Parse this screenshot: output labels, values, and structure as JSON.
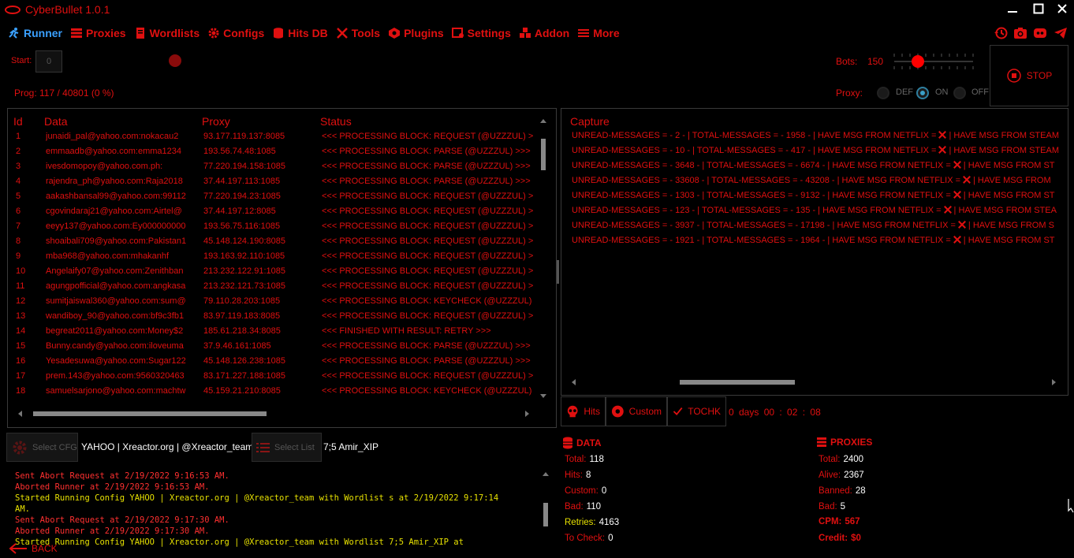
{
  "app": {
    "title": "CyberBullet 1.0.1"
  },
  "nav": [
    {
      "label": "Runner",
      "icon": "runner-icon"
    },
    {
      "label": "Proxies",
      "icon": "proxies-icon"
    },
    {
      "label": "Wordlists",
      "icon": "wordlists-icon"
    },
    {
      "label": "Configs",
      "icon": "gear-icon"
    },
    {
      "label": "Hits DB",
      "icon": "database-icon"
    },
    {
      "label": "Tools",
      "icon": "tools-icon"
    },
    {
      "label": "Plugins",
      "icon": "plugins-icon"
    },
    {
      "label": "Settings",
      "icon": "settings-icon"
    },
    {
      "label": "Addon",
      "icon": "addon-icon"
    },
    {
      "label": "More",
      "icon": "menu-icon"
    }
  ],
  "controls": {
    "start_label": "Start:",
    "start_value": "0",
    "prog": "Prog: 117 / 40801 (0 %)",
    "bots_label": "Bots:",
    "bots_value": "150",
    "bots_fraction": 0.3,
    "stop_label": "STOP",
    "proxy_label": "Proxy:",
    "proxy_options": [
      "DEF",
      "ON",
      "OFF"
    ],
    "proxy_selected": "ON"
  },
  "grid": {
    "headers": [
      "Id",
      "Data",
      "Proxy",
      "Status"
    ],
    "rows": [
      {
        "id": "1",
        "data": "junaidi_pal@yahoo.com:nokacau2",
        "proxy": "93.177.119.137:8085",
        "status": "<<< PROCESSING BLOCK: REQUEST (@UZZZUL) >"
      },
      {
        "id": "2",
        "data": "emmaadb@yahoo.com:emma1234",
        "proxy": "193.56.74.48:1085",
        "status": "<<< PROCESSING BLOCK: PARSE (@UZZZUL) >>>"
      },
      {
        "id": "3",
        "data": "ivesdomopoy@yahoo.com.ph:",
        "proxy": "77.220.194.158:1085",
        "status": "<<< PROCESSING BLOCK: PARSE (@UZZZUL) >>>"
      },
      {
        "id": "4",
        "data": "rajendra_ph@yahoo.com:Raja2018",
        "proxy": "37.44.197.113:1085",
        "status": "<<< PROCESSING BLOCK: PARSE (@UZZZUL) >>>"
      },
      {
        "id": "5",
        "data": "aakashbansal99@yahoo.com:99112",
        "proxy": "77.220.194.23:1085",
        "status": "<<< PROCESSING BLOCK: REQUEST (@UZZZUL) >"
      },
      {
        "id": "6",
        "data": "cgovindaraj21@yahoo.com:Airtel@",
        "proxy": "37.44.197.12:8085",
        "status": "<<< PROCESSING BLOCK: REQUEST (@UZZZUL) >"
      },
      {
        "id": "7",
        "data": "eeyy137@yahoo.com:Ey000000000",
        "proxy": "193.56.75.116:1085",
        "status": "<<< PROCESSING BLOCK: REQUEST (@UZZZUL) >"
      },
      {
        "id": "8",
        "data": "shoaibali709@yahoo.com:Pakistan1",
        "proxy": "45.148.124.190:8085",
        "status": "<<< PROCESSING BLOCK: REQUEST (@UZZZUL) >"
      },
      {
        "id": "9",
        "data": "mba968@yahoo.com:mhakanhf",
        "proxy": "193.163.92.110:1085",
        "status": "<<< PROCESSING BLOCK: REQUEST (@UZZZUL) >"
      },
      {
        "id": "10",
        "data": "Angelaify07@yahoo.com:Zenithban",
        "proxy": "213.232.122.91:1085",
        "status": "<<< PROCESSING BLOCK: REQUEST (@UZZZUL) >"
      },
      {
        "id": "11",
        "data": "agungpofficial@yahoo.com:angkasa",
        "proxy": "213.232.121.73:1085",
        "status": "<<< PROCESSING BLOCK: REQUEST (@UZZZUL) >"
      },
      {
        "id": "12",
        "data": "sumitjaiswal360@yahoo.com:sum@",
        "proxy": "79.110.28.203:1085",
        "status": "<<< PROCESSING BLOCK: KEYCHECK (@UZZZUL)"
      },
      {
        "id": "13",
        "data": "wandiboy_90@yahoo.com:bf9c3fb1",
        "proxy": "83.97.119.183:8085",
        "status": "<<< PROCESSING BLOCK: REQUEST (@UZZZUL) >"
      },
      {
        "id": "14",
        "data": "begreat2011@yahoo.com:Money$2",
        "proxy": "185.61.218.34:8085",
        "status": "<<< FINISHED WITH RESULT: RETRY >>>"
      },
      {
        "id": "15",
        "data": "Bunny.candy@yahoo.com:iloveuma",
        "proxy": "37.9.46.161:1085",
        "status": "<<< PROCESSING BLOCK: PARSE (@UZZZUL) >>>"
      },
      {
        "id": "16",
        "data": "Yesadesuwa@yahoo.com:Sugar122",
        "proxy": "45.148.126.238:1085",
        "status": "<<< PROCESSING BLOCK: PARSE (@UZZZUL) >>>"
      },
      {
        "id": "17",
        "data": "prem.143@yahoo.com:9560320463",
        "proxy": "83.171.227.188:1085",
        "status": "<<< PROCESSING BLOCK: REQUEST (@UZZZUL) >"
      },
      {
        "id": "18",
        "data": "samuelsarjono@yahoo.com:machtw",
        "proxy": "45.159.21.210:8085",
        "status": "<<< PROCESSING BLOCK: KEYCHECK (@UZZZUL)"
      }
    ]
  },
  "capture": {
    "header": "Capture",
    "rows": [
      {
        "a": "UNREAD-MESSAGES = - 2 - | TOTAL-MESSAGES = - 1958 - | HAVE MSG FROM NETFLIX =",
        "b": "| HAVE MSG FROM STEAM"
      },
      {
        "a": "UNREAD-MESSAGES = - 10 - | TOTAL-MESSAGES = - 417 - | HAVE MSG FROM NETFLIX =",
        "b": "| HAVE MSG FROM STEAM"
      },
      {
        "a": "UNREAD-MESSAGES = - 3648 - | TOTAL-MESSAGES = - 6674 - | HAVE MSG FROM NETFLIX =",
        "b": "| HAVE MSG FROM ST"
      },
      {
        "a": "UNREAD-MESSAGES = - 33608 - | TOTAL-MESSAGES = - 43208 - | HAVE MSG FROM NETFLIX =",
        "b": "| HAVE MSG FROM"
      },
      {
        "a": "UNREAD-MESSAGES = - 1303 - | TOTAL-MESSAGES = - 9132 - | HAVE MSG FROM NETFLIX =",
        "b": "| HAVE MSG FROM ST"
      },
      {
        "a": "UNREAD-MESSAGES = - 123 - | TOTAL-MESSAGES = - 135 - | HAVE MSG FROM NETFLIX =",
        "b": "| HAVE MSG FROM STEA"
      },
      {
        "a": "UNREAD-MESSAGES = - 3937 - | TOTAL-MESSAGES = - 17198 - | HAVE MSG FROM NETFLIX =",
        "b": "| HAVE MSG FROM S"
      },
      {
        "a": "UNREAD-MESSAGES = - 1921 - | TOTAL-MESSAGES = - 1964 - | HAVE MSG FROM NETFLIX =",
        "b": "| HAVE MSG FROM ST"
      }
    ]
  },
  "hit_tabs": {
    "hits": "Hits",
    "custom": "Custom",
    "tochk": "TOCHK"
  },
  "timer": "0  days  00 : 02 : 08",
  "bottom": {
    "select_cfg": "Select CFG",
    "cfg_name": "YAHOO | Xreactor.org | @Xreactor_team",
    "select_list": "Select List",
    "list_name": "7;5 Amir_XIP",
    "back": "BACK"
  },
  "log": [
    {
      "t": "Sent Abort Request at 2/19/2022 9:16:53 AM.",
      "c": "red"
    },
    {
      "t": "Aborted Runner at 2/19/2022 9:16:53 AM.",
      "c": "red"
    },
    {
      "t": "Started Running Config YAHOO | Xreactor.org | @Xreactor_team with Wordlist s at 2/19/2022 9:17:14",
      "c": "yel"
    },
    {
      "t": "AM.",
      "c": "yel"
    },
    {
      "t": "Sent Abort Request at 2/19/2022 9:17:30 AM.",
      "c": "red"
    },
    {
      "t": "Aborted Runner at 2/19/2022 9:17:30 AM.",
      "c": "red"
    },
    {
      "t": "Started Running Config YAHOO | Xreactor.org | @Xreactor_team with Wordlist 7;5 Amir_XIP at",
      "c": "yel"
    }
  ],
  "data_stats": {
    "title": "DATA",
    "total": {
      "label": "Total:",
      "value": "118"
    },
    "hits": {
      "label": "Hits:",
      "value": "8"
    },
    "custom": {
      "label": "Custom:",
      "value": "0"
    },
    "bad": {
      "label": "Bad:",
      "value": "110"
    },
    "retries": {
      "label": "Retries:",
      "value": "4163"
    },
    "tocheck": {
      "label": "To Check:",
      "value": "0"
    }
  },
  "proxy_stats": {
    "title": "PROXIES",
    "total": {
      "label": "Total:",
      "value": "2400"
    },
    "alive": {
      "label": "Alive:",
      "value": "2367"
    },
    "banned": {
      "label": "Banned:",
      "value": "28"
    },
    "bad": {
      "label": "Bad:",
      "value": "5"
    },
    "cpm": {
      "label": "CPM:",
      "value": "567"
    },
    "credit": {
      "label": "Credit:",
      "value": "$0"
    }
  },
  "colors": {
    "accent": "#e01010",
    "active": "#3aa0ff",
    "warning": "#e6e000"
  }
}
